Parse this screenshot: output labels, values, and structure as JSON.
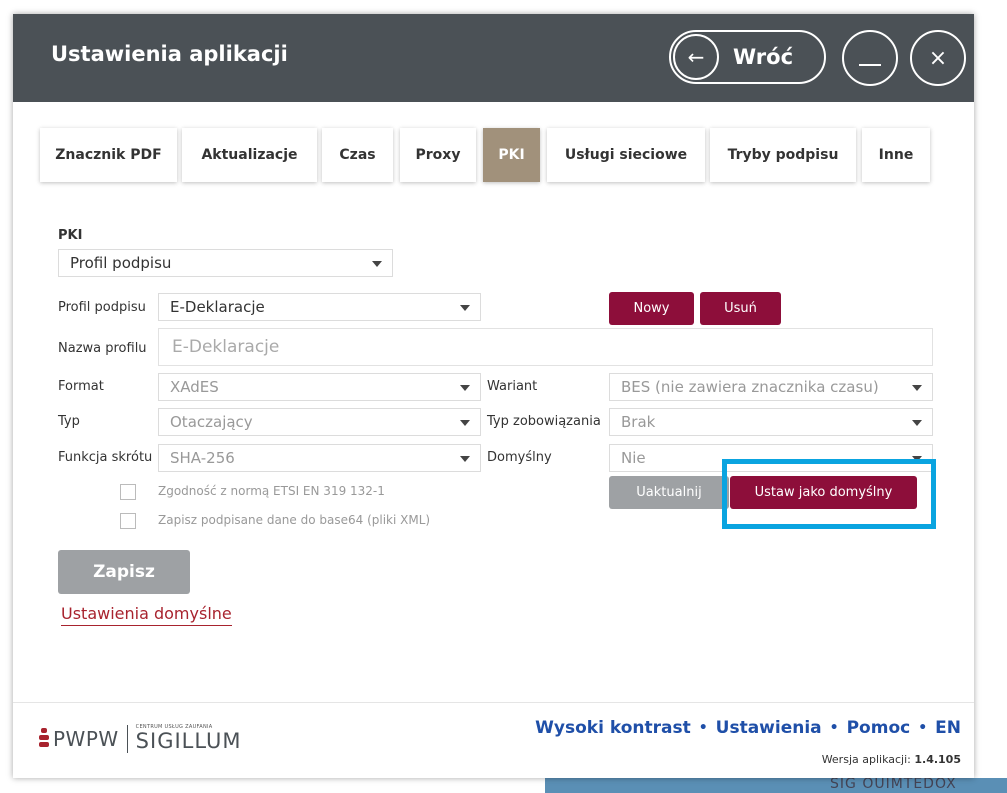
{
  "window": {
    "title": "Ustawienia aplikacji",
    "back_label": "Wróć",
    "back_arrow": "←",
    "close_glyph": "×"
  },
  "tabs": [
    {
      "label": "Znacznik PDF",
      "active": false
    },
    {
      "label": "Aktualizacje",
      "active": false
    },
    {
      "label": "Czas",
      "active": false
    },
    {
      "label": "Proxy",
      "active": false
    },
    {
      "label": "PKI",
      "active": true
    },
    {
      "label": "Usługi sieciowe",
      "active": false
    },
    {
      "label": "Tryby podpisu",
      "active": false
    },
    {
      "label": "Inne",
      "active": false
    }
  ],
  "pki": {
    "section_label": "PKI",
    "category_select": "Profil podpisu",
    "profile_label": "Profil podpisu",
    "profile_value": "E-Deklaracje",
    "new_button": "Nowy",
    "delete_button": "Usuń",
    "name_label": "Nazwa profilu",
    "name_placeholder": "E-Deklaracje",
    "format_label": "Format",
    "format_value": "XAdES",
    "variant_label": "Wariant",
    "variant_value": "BES (nie zawiera znacznika czasu)",
    "type_label": "Typ",
    "type_value": "Otaczający",
    "commitment_label": "Typ zobowiązania",
    "commitment_value": "Brak",
    "hash_label": "Funkcja skrótu",
    "hash_value": "SHA-256",
    "default_label": "Domyślny",
    "default_value": "Nie",
    "update_button": "Uaktualnij",
    "set_default_button": "Ustaw jako domyślny",
    "checkbox_etsi": "Zgodność z normą ETSI EN 319 132-1",
    "checkbox_base64": "Zapisz podpisane dane do base64 (pliki XML)",
    "save_button": "Zapisz",
    "defaults_link": "Ustawienia domyślne"
  },
  "footer": {
    "logo_pwpw": "PWPW",
    "logo_small": "CENTRUM USŁUG ZAUFANIA",
    "logo_sigillum": "SIGILLUM",
    "links": [
      "Wysoki kontrast",
      "Ustawienia",
      "Pomoc",
      "EN"
    ],
    "separator": "•",
    "version_label": "Wersja aplikacji:",
    "version_value": "1.4.105"
  },
  "background": {
    "residue_text": "SIG OUIMTEDOX"
  },
  "colors": {
    "titlebar": "#4b5156",
    "accent_red": "#8d0e3a",
    "active_tab": "#a1917b",
    "highlight": "#0aa4e0",
    "link_blue": "#1f4fa8"
  }
}
